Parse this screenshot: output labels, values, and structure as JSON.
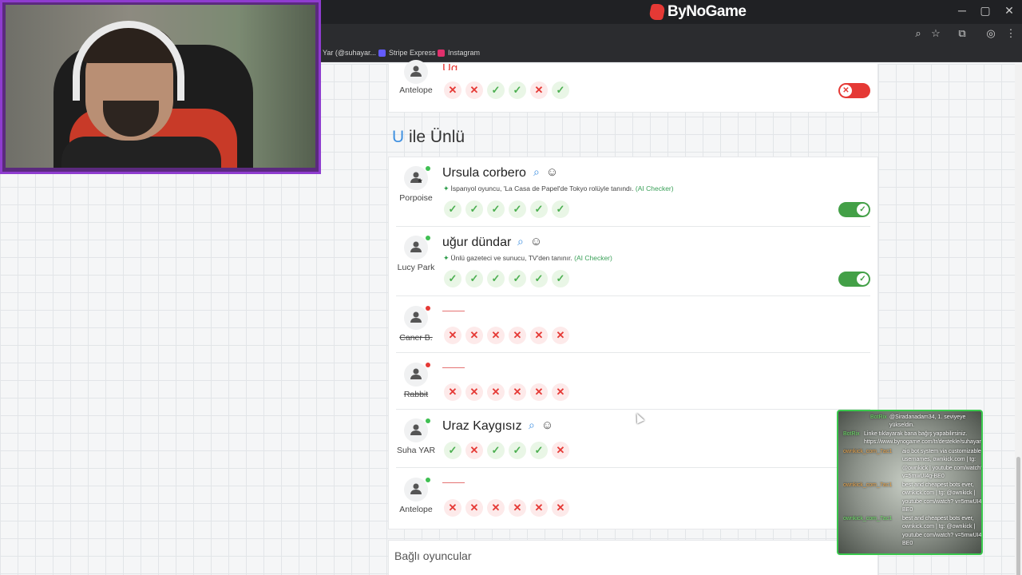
{
  "browser": {
    "brand": "ByNoGame",
    "window_controls": [
      "─",
      "▢",
      "✕"
    ],
    "bookmarks": [
      {
        "label": "Yar (@suhayar...",
        "color": "#333333"
      },
      {
        "label": "Stripe Express",
        "color": "#635bff"
      },
      {
        "label": "Instagram",
        "color": "#e1306c"
      }
    ]
  },
  "top_row": {
    "answer": "Ug",
    "player": "Antelope",
    "marks": [
      "no",
      "no",
      "ok",
      "ok",
      "no",
      "ok"
    ],
    "toggle": "off"
  },
  "section": {
    "letter": "U",
    "title": "ile Ünlü"
  },
  "rows": [
    {
      "player": "Porpoise",
      "status": "online",
      "answer": "Ursula corbero",
      "ai_note": "İspanyol oyuncu, 'La Casa de Papel'de Tokyo rolüyle tanındı.",
      "ai_checker": "(AI Checker)",
      "marks": [
        "ok",
        "ok",
        "ok",
        "ok",
        "ok",
        "ok"
      ],
      "toggle": "on"
    },
    {
      "player": "Lucy Park",
      "status": "online",
      "answer": "uğur dündar",
      "ai_note": "Ünlü gazeteci ve sunucu, TV'den tanınır.",
      "ai_checker": "(AI Checker)",
      "marks": [
        "ok",
        "ok",
        "ok",
        "ok",
        "ok",
        "ok"
      ],
      "toggle": "on"
    },
    {
      "player": "Caner B.",
      "status": "offline",
      "answer": "",
      "marks": [
        "no",
        "no",
        "no",
        "no",
        "no",
        "no"
      ]
    },
    {
      "player": "Rabbit",
      "status": "offline",
      "answer": "",
      "marks": [
        "no",
        "no",
        "no",
        "no",
        "no",
        "no"
      ]
    },
    {
      "player": "Suha YAR",
      "status": "online",
      "answer": "Uraz Kaygısız",
      "marks": [
        "ok",
        "no",
        "ok",
        "ok",
        "ok",
        "no"
      ]
    },
    {
      "player": "Antelope",
      "status": "online",
      "answer": "",
      "marks": [
        "no",
        "no",
        "no",
        "no",
        "no",
        "no"
      ]
    }
  ],
  "connected_players_label": "Bağlı oyuncular",
  "chat": [
    {
      "user": "BotRix",
      "text": "@Siradanadam34, 1. seviyeye yükseldin."
    },
    {
      "user": "BotRix",
      "text": "Linke tıklayarak bana bağış yapabilirsiniz. https://www.bynogame.com/tr/destekle/suhayar"
    },
    {
      "user": "ownkick_com_7ac1",
      "text": "aio bot system via customizable usernames, ownkick.com | tg: @ownkick | youtube com/watch?v=5mwUI4g-BE0"
    },
    {
      "user": "ownkick_com_7ac1",
      "text": "best and cheapest bots ever, ownkick.com | tg: @ownkick | youtube com/watch? v=5mwUI4g-BE0"
    },
    {
      "user": "ownkick_com_7ac1",
      "text": "best and cheapest bots ever, ownkick.com | tg: @ownkick | youtube com/watch? v=5mwUI4g-BE0"
    }
  ]
}
